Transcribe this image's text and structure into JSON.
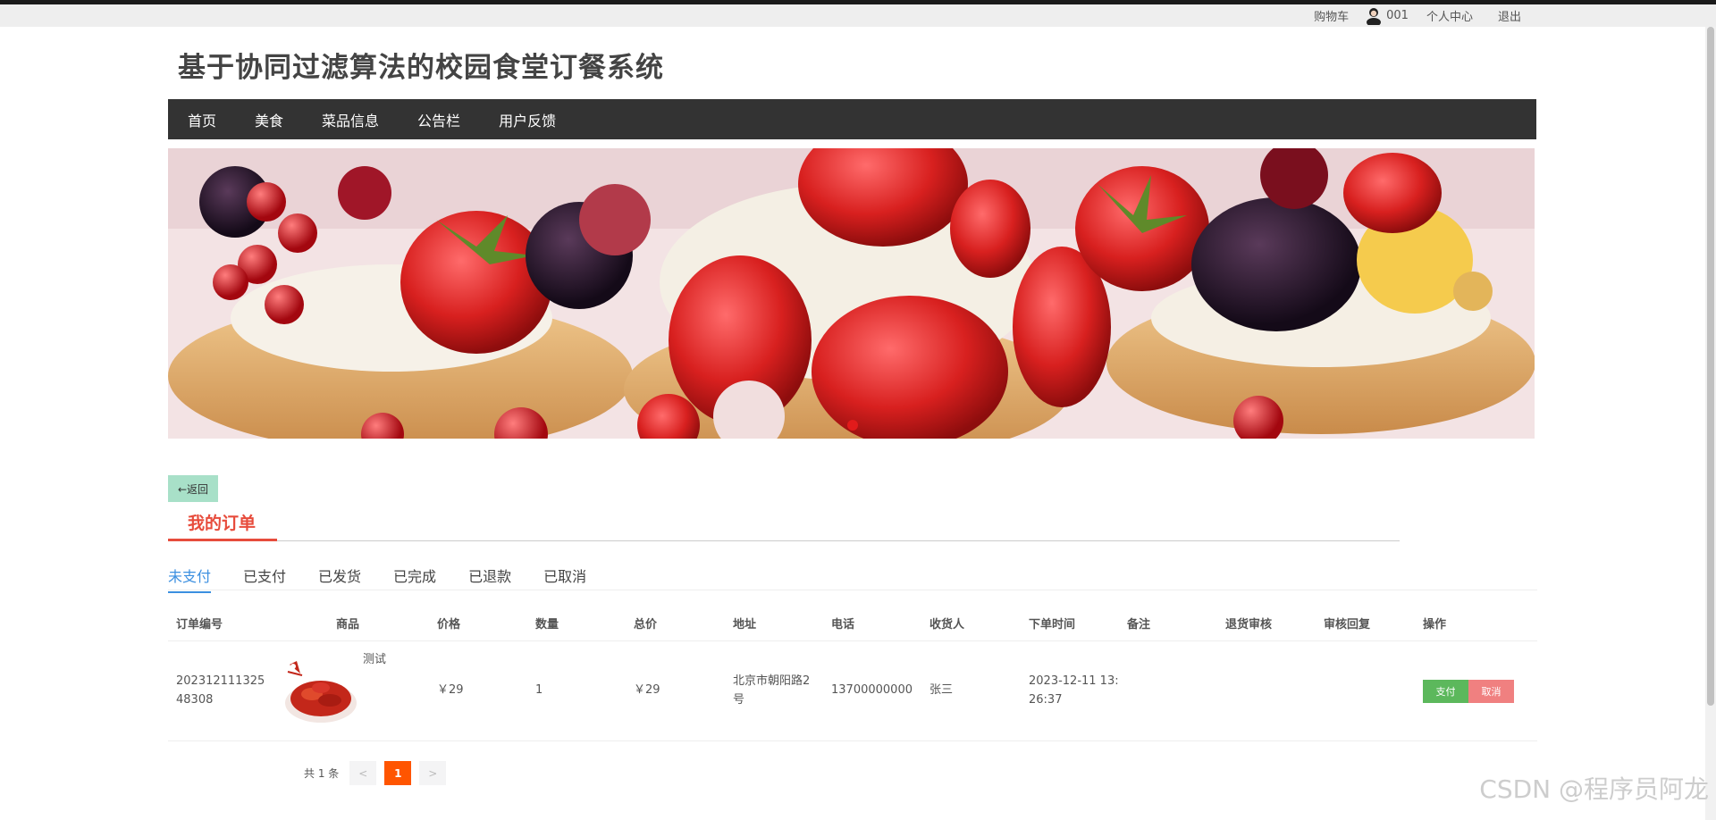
{
  "topbar": {
    "cart": "购物车",
    "username": "001",
    "center": "个人中心",
    "logout": "退出"
  },
  "site": {
    "title": "基于协同过滤算法的校园食堂订餐系统"
  },
  "nav": {
    "items": [
      "首页",
      "美食",
      "菜品信息",
      "公告栏",
      "用户反馈"
    ]
  },
  "back_label": "←返回",
  "order_section": {
    "title": "我的订单"
  },
  "status_tabs": [
    "未支付",
    "已支付",
    "已发货",
    "已完成",
    "已退款",
    "已取消"
  ],
  "table": {
    "headers": [
      "订单编号",
      "商品",
      "价格",
      "数量",
      "总价",
      "地址",
      "电话",
      "收货人",
      "下单时间",
      "备注",
      "退货审核",
      "审核回复",
      "操作"
    ],
    "row": {
      "order_no_line1": "202312111325",
      "order_no_line2": "48308",
      "product_name": "测试",
      "price": "￥29",
      "quantity": "1",
      "total": "￥29",
      "address_line1": "北京市朝阳路2",
      "address_line2": "号",
      "phone": "13700000000",
      "receiver": "张三",
      "time_line1": "2023-12-11 13:",
      "time_line2": "26:37",
      "note": "",
      "return_review": "",
      "review_reply": "",
      "pay_label": "支付",
      "cancel_label": "取消"
    }
  },
  "pagination": {
    "total_text": "共 1 条",
    "prev": "<",
    "current": "1",
    "next": ">"
  },
  "watermark": "CSDN @程序员阿龙",
  "colors": {
    "nav_bg": "#333333",
    "accent_red": "#e74c3c",
    "tab_active": "#3b8fe0",
    "pay_green": "#5cb85c",
    "cancel_red": "#f08080",
    "page_current": "#ff5500",
    "back_btn": "#a8e0c8"
  }
}
